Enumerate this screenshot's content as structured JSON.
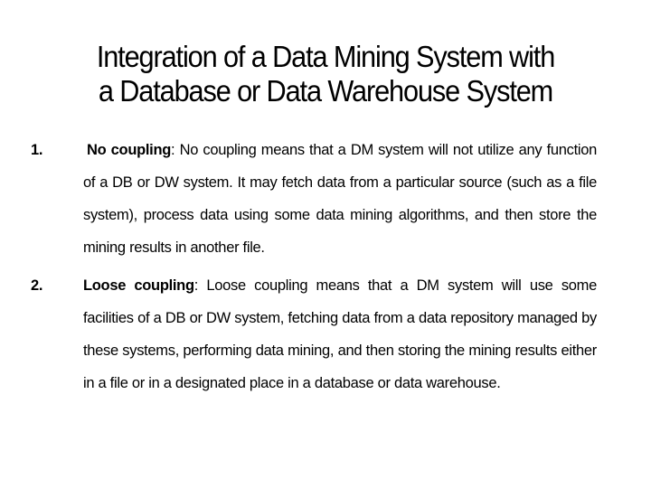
{
  "slide": {
    "title_line1": "Integration of a Data Mining System with",
    "title_line2": "a Database or Data Warehouse System",
    "items": [
      {
        "number": "1.",
        "term": "No coupling",
        "separator": ":",
        "text": " No coupling means that a DM system will not utilize any function of a DB or DW system. It may fetch data from a particular source (such as a file system), process data using some data mining algorithms, and then store the mining results in another file."
      },
      {
        "number": "2.",
        "term": "Loose coupling",
        "separator": ":",
        "text": " Loose coupling means that a DM system will use some facilities of a DB or DW system, fetching data from a data repository managed by these systems, performing data mining, and then storing the mining results either in a file or in a designated place in a database or data warehouse."
      }
    ]
  }
}
